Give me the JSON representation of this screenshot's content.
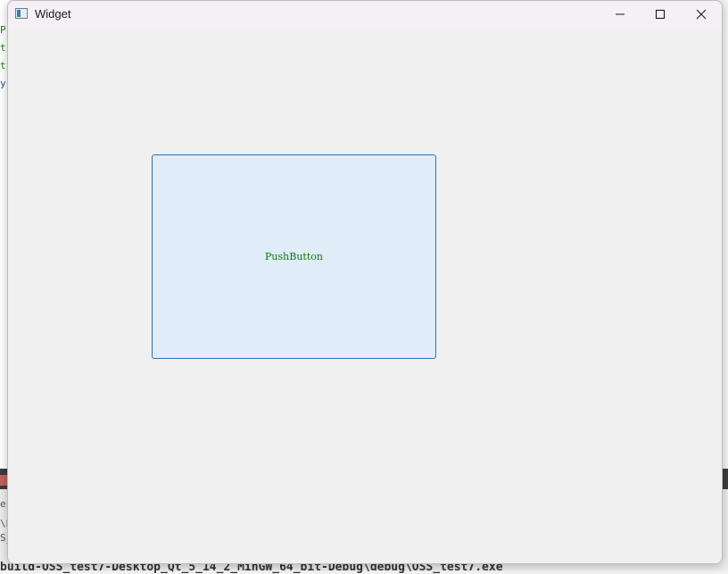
{
  "window": {
    "title": "Widget",
    "controls": {
      "minimize_icon": "minimize-icon",
      "maximize_icon": "maximize-icon",
      "close_icon": "close-icon"
    }
  },
  "main": {
    "push_button_label": "PushButton"
  },
  "background": {
    "code_fragments": [
      "P",
      "t",
      "t",
      "y"
    ],
    "left_fragments": [
      "es",
      "\\E",
      "S_"
    ],
    "path_text": "build-OSS_test7-Desktop_Qt_5_14_2_MinGW_64_bit-Debug\\debug\\OSS_test7.exe"
  },
  "colors": {
    "button_fill": "#e0ecf8",
    "button_border": "#2a73c0",
    "button_text": "#0a7a0a",
    "window_bg": "#f0f0f0",
    "titlebar_bg": "#f6f0f6"
  }
}
